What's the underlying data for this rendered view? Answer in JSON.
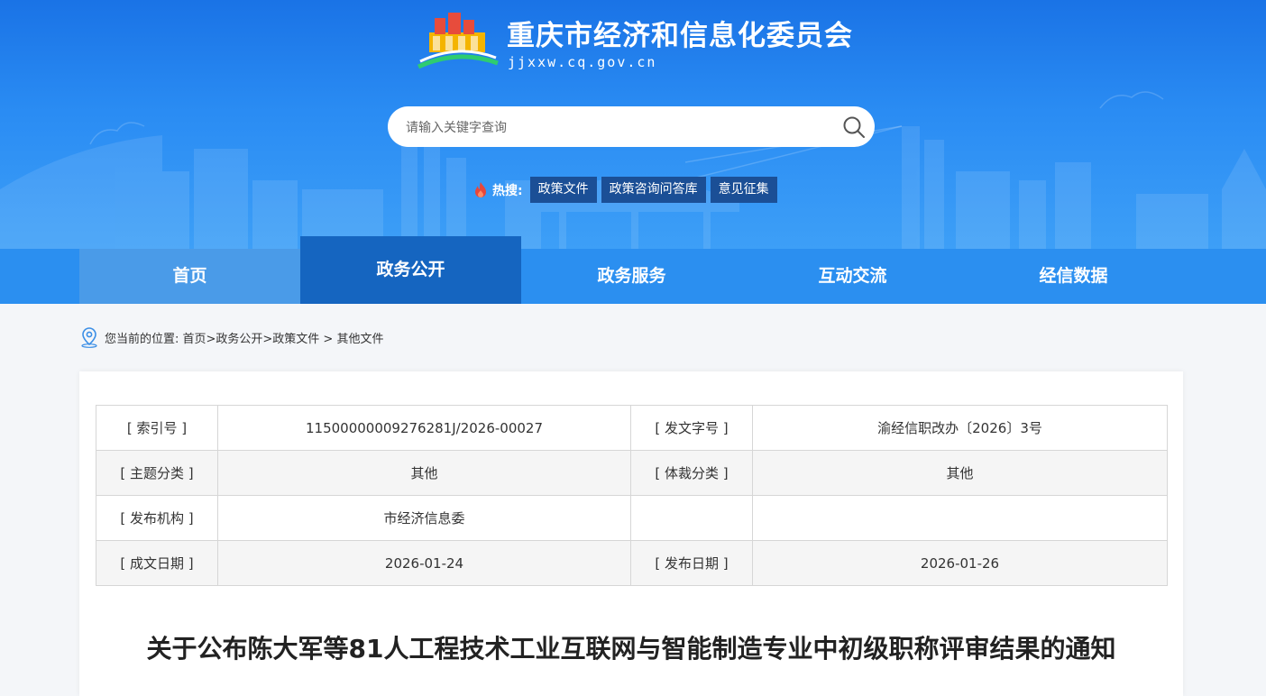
{
  "site": {
    "title": "重庆市经济和信息化委员会",
    "domain": "jjxxw.cq.gov.cn"
  },
  "search": {
    "placeholder": "请输入关键字查询"
  },
  "hot_search": {
    "label": "热搜:",
    "tags": [
      "政策文件",
      "政策咨询问答库",
      "意见征集"
    ]
  },
  "nav": {
    "items": [
      "首页",
      "政务公开",
      "政务服务",
      "互动交流",
      "经信数据"
    ],
    "active": "政务公开"
  },
  "breadcrumb": {
    "text": "您当前的位置:  首页>政务公开>政策文件 > 其他文件"
  },
  "meta_table": {
    "rows": [
      [
        "[ 索引号 ]",
        "11500000009276281J/2026-00027",
        "[ 发文字号 ]",
        "渝经信职改办〔2026〕3号"
      ],
      [
        "[ 主题分类 ]",
        "其他",
        "[ 体裁分类 ]",
        "其他"
      ],
      [
        "[ 发布机构 ]",
        "市经济信息委",
        "",
        ""
      ],
      [
        "[ 成文日期 ]",
        "2026-01-24",
        "[ 发布日期 ]",
        "2026-01-26"
      ]
    ]
  },
  "document": {
    "title": "关于公布陈大军等81人工程技术工业互联网与智能制造专业中初级职称评审结果的通知"
  },
  "colors": {
    "header_top": "#1a73e6",
    "nav_bg": "#2b8ff0",
    "nav_active": "#1565c0",
    "hot_tag_bg": "#1b4f96"
  }
}
